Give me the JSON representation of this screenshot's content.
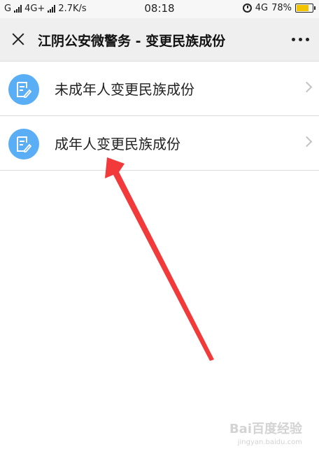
{
  "status_bar": {
    "network_left": "G",
    "network_mid": "4G+",
    "speed": "2.7K/s",
    "time": "08:18",
    "network_right": "4G",
    "battery": "78%"
  },
  "nav": {
    "title": "江阴公安微警务 - 变更民族成份"
  },
  "list": {
    "items": [
      {
        "label": "未成年人变更民族成份"
      },
      {
        "label": "成年人变更民族成份"
      }
    ]
  },
  "watermark": {
    "brand": "Bai百度经验",
    "url": "jingyan.baidu.com"
  },
  "colors": {
    "icon_bg": "#5aaef5",
    "arrow": "#f23a3a"
  }
}
